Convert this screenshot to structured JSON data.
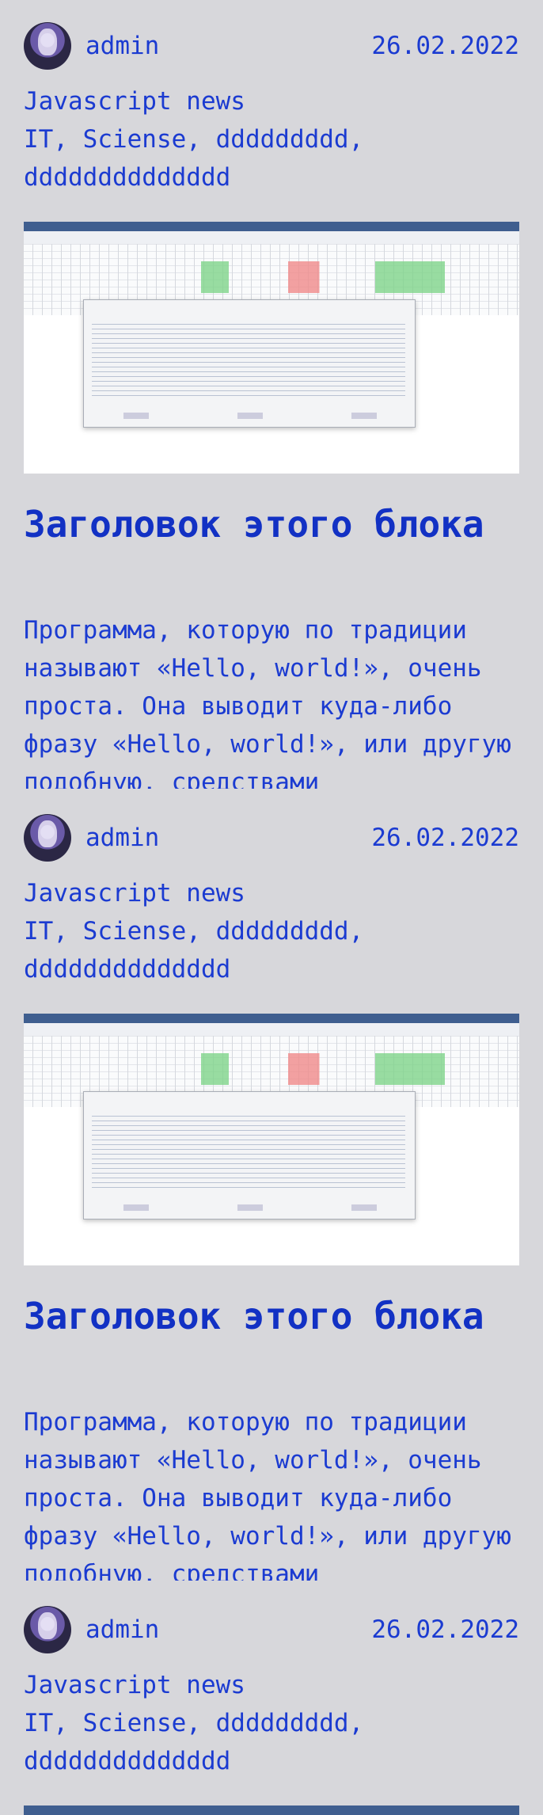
{
  "posts": [
    {
      "author": "admin",
      "date": "26.02.2022",
      "topic": "Javascript news",
      "tags": "IT, Sciense, ddddddddd, dddddddddddddd",
      "block_title": "Заголовок этого блока",
      "block_text": "Программа, которую по традиции называют «Hello, world!», очень проста. Она выводит куда-либо фразу «Hello, world!», или другую подобную, средствами"
    },
    {
      "author": "admin",
      "date": "26.02.2022",
      "topic": "Javascript news",
      "tags": "IT, Sciense, ddddddddd, dddddddddddddd",
      "block_title": "Заголовок этого блока",
      "block_text": "Программа, которую по традиции называют «Hello, world!», очень проста. Она выводит куда-либо фразу «Hello, world!», или другую подобную, средствами"
    },
    {
      "author": "admin",
      "date": "26.02.2022",
      "topic": "Javascript news",
      "tags": "IT, Sciense, ddddddddd, dddddddddddddd"
    }
  ],
  "colors": {
    "background": "#d7d7db",
    "text": "#1b3bd1",
    "heading": "#1231c4"
  },
  "icons": {
    "avatar": "user-avatar",
    "post_image": "app-screenshot-image"
  }
}
